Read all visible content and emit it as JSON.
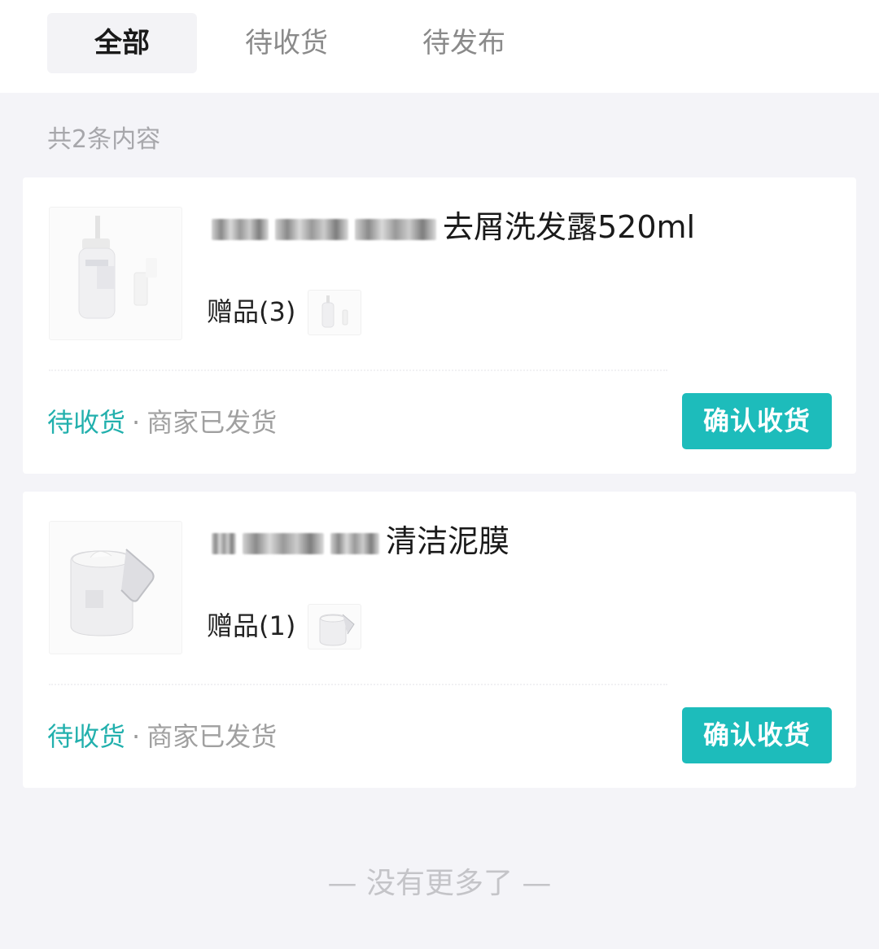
{
  "tabs": [
    {
      "label": "全部",
      "active": true
    },
    {
      "label": "待收货",
      "active": false
    },
    {
      "label": "待发布",
      "active": false
    }
  ],
  "count_text": "共2条内容",
  "orders": [
    {
      "title_visible": "去屑洗发露520ml",
      "gift_label": "赠品(3)",
      "status": "待收货",
      "status_sep": "·",
      "status_detail": "商家已发货",
      "button": "确认收货",
      "image": "shampoo-bottle"
    },
    {
      "title_visible": "清洁泥膜",
      "gift_label": "赠品(1)",
      "status": "待收货",
      "status_sep": "·",
      "status_detail": "商家已发货",
      "button": "确认收货",
      "image": "cream-jar"
    }
  ],
  "footer": "— 没有更多了 —",
  "colors": {
    "accent": "#1dbcbb",
    "status_text": "#22b0ad",
    "background": "#f4f4f8"
  }
}
